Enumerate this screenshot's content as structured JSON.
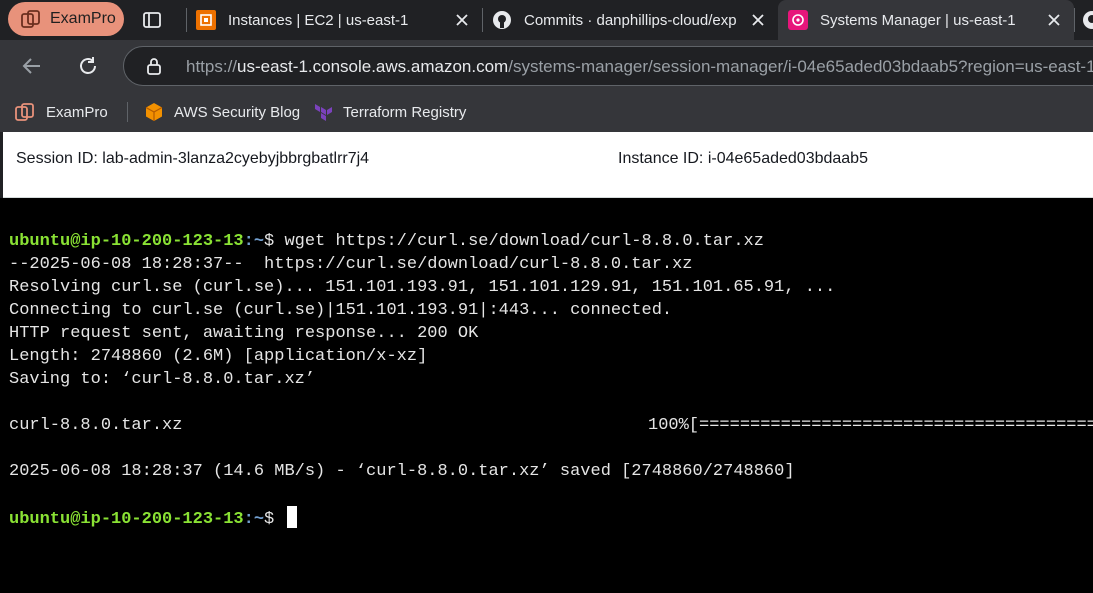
{
  "browser": {
    "profile_label": "ExamPro",
    "tabs": [
      {
        "title": "Instances | EC2 | us-east-1",
        "favicon": "aws-ec2-icon"
      },
      {
        "title": "Commits · danphillips-cloud/exp",
        "favicon": "github-icon"
      },
      {
        "title": "Systems Manager | us-east-1",
        "favicon": "systems-manager-icon"
      }
    ],
    "url_scheme": "https://",
    "url_host": "us-east-1.console.aws.amazon.com",
    "url_path": "/systems-manager/session-manager/i-04e65aded03bdaab5?region=us-east-1",
    "bookmarks": [
      {
        "label": "ExamPro"
      },
      {
        "label": "AWS Security Blog"
      },
      {
        "label": "Terraform Registry"
      }
    ]
  },
  "session": {
    "session_id_text": "Session ID: lab-admin-3lanza2cyebyjbbrgbatlrr7j4",
    "instance_id_text": "Instance ID: i-04e65aded03bdaab5"
  },
  "terminal": {
    "prompt_user": "ubuntu@ip-10-200-123-13",
    "prompt_path": ":~",
    "prompt_symbol": "$ ",
    "command": "wget https://curl.se/download/curl-8.8.0.tar.xz",
    "output": [
      "--2025-06-08 18:28:37--  https://curl.se/download/curl-8.8.0.tar.xz",
      "Resolving curl.se (curl.se)... 151.101.193.91, 151.101.129.91, 151.101.65.91, ...",
      "Connecting to curl.se (curl.se)|151.101.193.91|:443... connected.",
      "HTTP request sent, awaiting response... 200 OK",
      "Length: 2748860 (2.6M) [application/x-xz]",
      "Saving to: ‘curl-8.8.0.tar.xz’"
    ],
    "progress_file": "curl-8.8.0.tar.xz",
    "progress_bar": "100%[=======================================",
    "saved_line": "2025-06-08 18:28:37 (14.6 MB/s) - ‘curl-8.8.0.tar.xz’ saved [2748860/2748860]"
  },
  "colors": {
    "tab_strip": "#202124",
    "toolbar": "#35363a",
    "profile_pill": "#e8927b",
    "prompt_user": "#8ae234",
    "prompt_path": "#729fcf",
    "terminal_bg": "#000000"
  }
}
